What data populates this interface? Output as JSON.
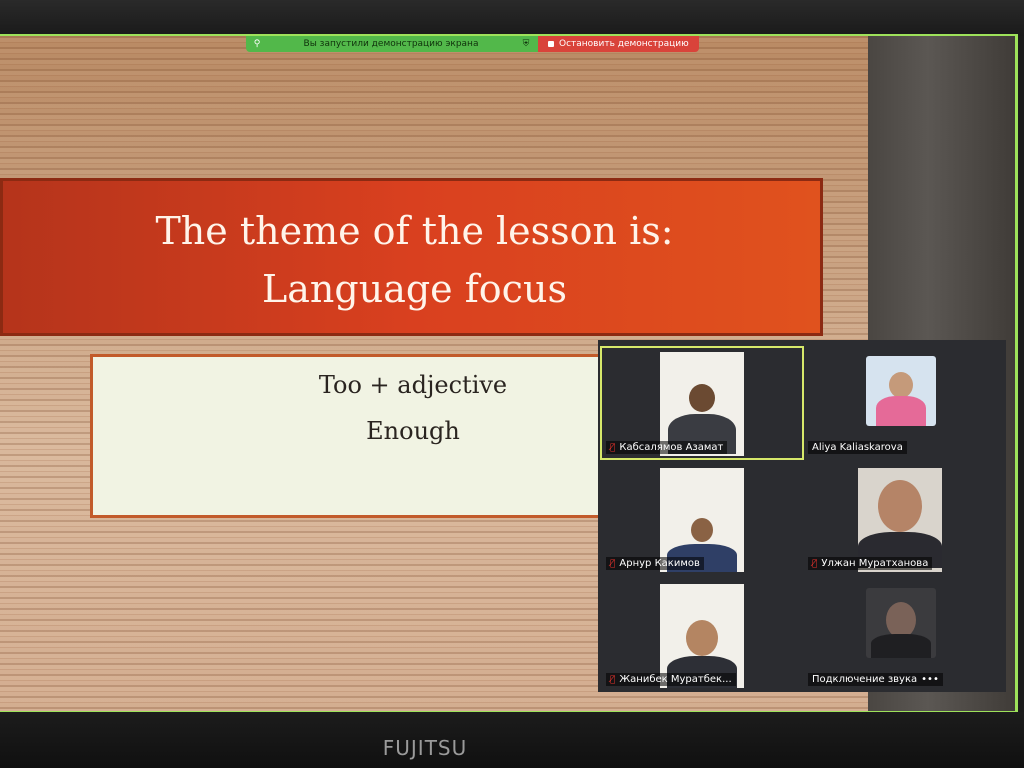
{
  "share_bar": {
    "message": "Вы запустили демонстрацию экрана",
    "stop_label": "Остановить демонстрацию"
  },
  "slide": {
    "title_line1": "The theme of the lesson is:",
    "title_line2": "Language focus",
    "content_line1": "Too + adjective",
    "content_line2": "Enough"
  },
  "participants": [
    {
      "name": "Кабсалямов Азамат",
      "muted": true,
      "active_speaker": true,
      "video": true
    },
    {
      "name": "Aliya Kaliaskarova",
      "muted": false,
      "video": true
    },
    {
      "name": "Арнур Какимов",
      "muted": true,
      "video": true
    },
    {
      "name": "Улжан Муратханова",
      "muted": true,
      "video": true
    },
    {
      "name": "Жанибек Муратбек...",
      "muted": true,
      "video": true
    },
    {
      "name": "Подключение звука",
      "muted": false,
      "video": true,
      "status_dots": "•••"
    }
  ],
  "monitor": {
    "brand": "FUJITSU"
  },
  "colors": {
    "share_green": "#52b84a",
    "stop_red": "#d9433a",
    "title_bg": "#d9401f",
    "active_border": "#d6e86a"
  }
}
